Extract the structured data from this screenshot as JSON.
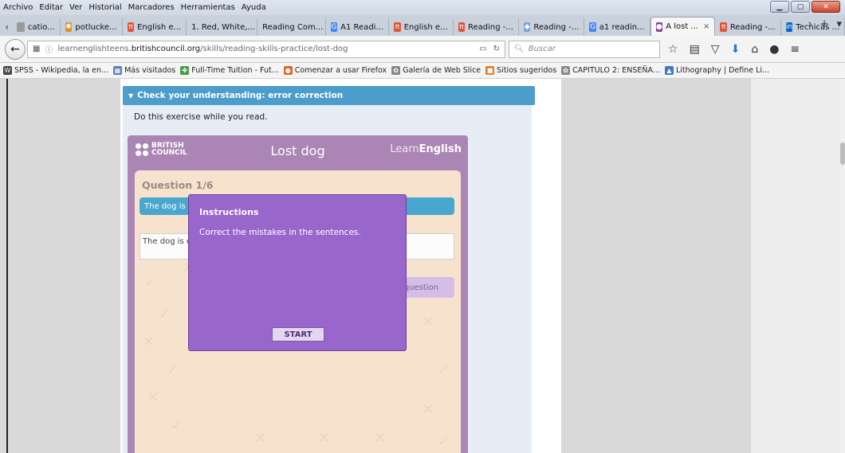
{
  "menu": [
    "Archivo",
    "Editar",
    "Ver",
    "Historial",
    "Marcadores",
    "Herramientas",
    "Ayuda"
  ],
  "tabs": [
    {
      "label": "catio...",
      "icon_color": "#9a9a9a",
      "icon": ""
    },
    {
      "label": "potlucke...",
      "icon_color": "#e0902a",
      "icon": "✱"
    },
    {
      "label": "English e...",
      "icon_color": "#e0553a",
      "icon": "π"
    },
    {
      "label": "1. Red, White,...",
      "icon_color": "",
      "icon": ""
    },
    {
      "label": "Reading Com...",
      "icon_color": "",
      "icon": ""
    },
    {
      "label": "A1 Readi...",
      "icon_color": "#4285f4",
      "icon": "G"
    },
    {
      "label": "English e...",
      "icon_color": "#e0553a",
      "icon": "π"
    },
    {
      "label": "Reading -...",
      "icon_color": "#e0553a",
      "icon": "π"
    },
    {
      "label": "Reading -...",
      "icon_color": "#7aa6d6",
      "icon": "◆"
    },
    {
      "label": "a1 readin...",
      "icon_color": "#4285f4",
      "icon": "G"
    },
    {
      "label": "A lost ...",
      "icon_color": "#8e3f8e",
      "icon": "●",
      "active": true
    },
    {
      "label": "Reading -...",
      "icon_color": "#e0553a",
      "icon": "π"
    },
    {
      "label": "Tecnicas ...",
      "icon_color": "#0a66c2",
      "icon": "in"
    }
  ],
  "url": {
    "prefix": "learnenglishteens.",
    "host": "britishcouncil.org",
    "path": "/skills/reading-skills-practice/lost-dog"
  },
  "search": {
    "placeholder": "Buscar"
  },
  "bookmarks": [
    {
      "label": "SPSS - Wikipedia, la en...",
      "icon": "W",
      "icon_color": "#444"
    },
    {
      "label": "Más visitados",
      "icon": "▦",
      "icon_color": "#5b7fb5"
    },
    {
      "label": "Full-Time Tuition - Fut...",
      "icon": "✤",
      "icon_color": "#4a9a4a"
    },
    {
      "label": "Comenzar a usar Firefox",
      "icon": "●",
      "icon_color": "#e06a1a"
    },
    {
      "label": "Galería de Web Slice",
      "icon": "✿",
      "icon_color": "#888"
    },
    {
      "label": "Sitios sugeridos",
      "icon": "■",
      "icon_color": "#e08020"
    },
    {
      "label": "CAPITULO 2: ENSEÑA...",
      "icon": "✿",
      "icon_color": "#888"
    },
    {
      "label": "Lithography | Define Li...",
      "icon": "▲",
      "icon_color": "#3a7ac7"
    }
  ],
  "page": {
    "section_header": "Check your understanding: error correction",
    "instruction": "Do this exercise while you read.",
    "lesson": {
      "logo_text_line1": "BRITISH",
      "logo_text_line2": "COUNCIL",
      "title": "Lost dog",
      "brand_light": "Learn",
      "brand_bold": "English"
    },
    "question": {
      "number": "Question 1/6",
      "prompt": "The dog is called Berry.",
      "answer_value": "The dog is called Berry.",
      "next_label": "question"
    },
    "modal": {
      "title": "Instructions",
      "text": "Correct the mistakes in the sentences.",
      "start_label": "START"
    }
  }
}
